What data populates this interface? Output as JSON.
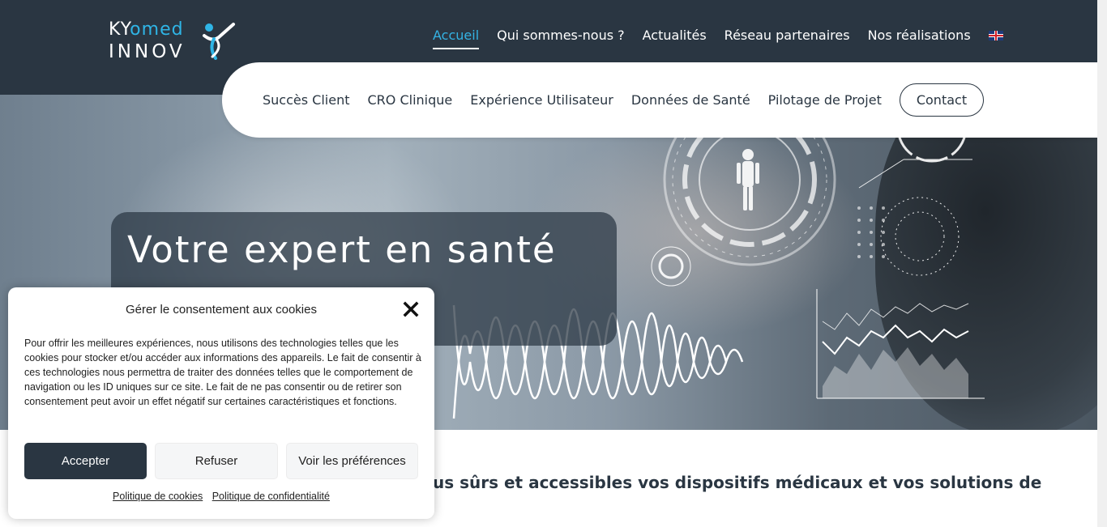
{
  "header": {
    "logo": {
      "line1_k": "KY",
      "line1_o": "o",
      "line1_med": "med",
      "line2": "INNOV"
    },
    "nav": [
      {
        "label": "Accueil"
      },
      {
        "label": "Qui sommes-nous ?"
      },
      {
        "label": "Actualités"
      },
      {
        "label": "Réseau partenaires"
      },
      {
        "label": "Nos réalisations"
      }
    ],
    "language_flag": "uk-flag-icon"
  },
  "subnav": {
    "items": [
      {
        "label": "Succès Client"
      },
      {
        "label": "CRO Clinique"
      },
      {
        "label": "Expérience Utilisateur"
      },
      {
        "label": "Données de Santé"
      },
      {
        "label": "Pilotage de Projet"
      }
    ],
    "contact_label": "Contact"
  },
  "hero": {
    "title": "Votre expert en santé"
  },
  "intro": {
    "text": "us sûrs et accessibles vos dispositifs médicaux et vos solutions de"
  },
  "cookie_dialog": {
    "title": "Gérer le consentement aux cookies",
    "body": "Pour offrir les meilleures expériences, nous utilisons des technologies telles que les cookies pour stocker et/ou accéder aux informations des appareils. Le fait de consentir à ces technologies nous permettra de traiter des données telles que le comportement de navigation ou les ID uniques sur ce site. Le fait de ne pas consentir ou de retirer son consentement peut avoir un effet négatif sur certaines caractéristiques et fonctions.",
    "accept_label": "Accepter",
    "refuse_label": "Refuser",
    "prefs_label": "Voir les préférences",
    "cookie_policy_label": "Politique de cookies",
    "privacy_policy_label": "Politique de confidentialité"
  },
  "colors": {
    "header_bg": "#2a3642",
    "accent": "#34b3e4",
    "button_dark": "#2a3642"
  }
}
